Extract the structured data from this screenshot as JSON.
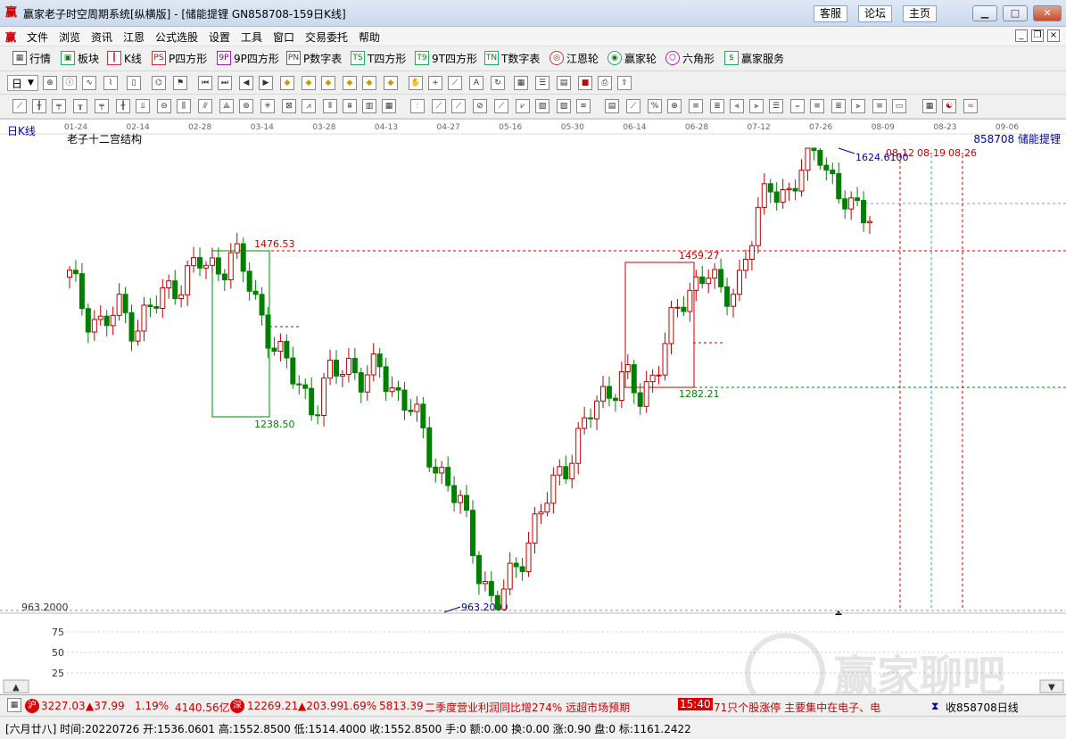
{
  "window": {
    "title": "赢家老子时空周期系统[纵横版] - [储能提锂  GN858708-159日K线]",
    "buttons": [
      "客服",
      "论坛",
      "主页"
    ]
  },
  "menu": [
    "文件",
    "浏览",
    "资讯",
    "江恩",
    "公式选股",
    "设置",
    "工具",
    "窗口",
    "交易委托",
    "帮助"
  ],
  "toolbar1": [
    {
      "label": "行情",
      "icon": "grid-icon"
    },
    {
      "label": "板块",
      "icon": "blocks-icon"
    },
    {
      "label": "K线",
      "icon": "candles-icon"
    },
    {
      "label": "P四方形",
      "icon": "PS"
    },
    {
      "label": "9P四方形",
      "icon": "9P"
    },
    {
      "label": "P数字表",
      "icon": "PN"
    },
    {
      "label": "T四方形",
      "icon": "TS"
    },
    {
      "label": "9T四方形",
      "icon": "T9"
    },
    {
      "label": "T数字表",
      "icon": "TN"
    },
    {
      "label": "江恩轮",
      "icon": "wheel-icon"
    },
    {
      "label": "赢家轮",
      "icon": "big-icon"
    },
    {
      "label": "六角形",
      "icon": "hex-icon"
    },
    {
      "label": "赢家服务",
      "icon": "dollar-icon"
    }
  ],
  "toolbar2": {
    "period": "日"
  },
  "chart": {
    "period_label": "日K线",
    "indicator_title": "老子十二宫结构",
    "code_name": "858708 储能提锂",
    "date_ticks": [
      "01-24",
      "02-14",
      "02-28",
      "03-14",
      "03-28",
      "04-13",
      "04-27",
      "05-16",
      "05-30",
      "06-14",
      "06-28",
      "07-12",
      "07-26",
      "08-09",
      "08-23",
      "09-06"
    ],
    "future_dates": [
      "08-12",
      "08-19",
      "08-26"
    ],
    "annotations": {
      "high": "1624.6100",
      "low": "963.2000",
      "low_axis": "963.2000",
      "box1_top": "1476.53",
      "box1_bottom": "1238.50",
      "box2_top": "1459.27",
      "box2_bottom": "1282.21"
    },
    "sub_axis": [
      "75",
      "50",
      "25"
    ],
    "colors": {
      "up": "#c00000",
      "down": "#008000",
      "box1": "#008000",
      "box2": "#c00000"
    }
  },
  "chart_data": {
    "type": "candlestick",
    "title": "老子十二宫结构",
    "x_ticks": [
      "01-24",
      "02-14",
      "02-28",
      "03-14",
      "03-28",
      "04-13",
      "04-27",
      "05-16",
      "05-30",
      "06-14",
      "06-28",
      "07-12",
      "07-26",
      "08-09",
      "08-23",
      "09-06"
    ],
    "marked_levels": [
      1624.61,
      1476.53,
      1459.27,
      1282.21,
      1238.5,
      963.2
    ],
    "close_path": [
      1440,
      1390,
      1370,
      1395,
      1370,
      1395,
      1420,
      1440,
      1460,
      1450,
      1476,
      1430,
      1370,
      1320,
      1290,
      1250,
      1300,
      1320,
      1290,
      1310,
      1275,
      1250,
      1190,
      1150,
      1110,
      1030,
      963,
      1010,
      1060,
      1110,
      1160,
      1200,
      1250,
      1280,
      1300,
      1260,
      1320,
      1380,
      1420,
      1459,
      1400,
      1440,
      1520,
      1570,
      1560,
      1600,
      1624,
      1560,
      1530,
      1540
    ]
  },
  "status1": {
    "sh_label": "沪",
    "sh_value": "3227.03",
    "sh_change": "▲37.99",
    "sh_pct": "1.19%",
    "sh_amount": "4140.56亿",
    "sz_label": "深",
    "sz_value": "12269.21",
    "sz_change": "▲203.99",
    "sz_pct": "1.69%",
    "sz_amount": "5813.39",
    "news1": "二季度营业利润同比增274% 远超市场预期",
    "time": "15:40",
    "news2": "71只个股涨停 主要集中在电子、电",
    "right": "收858708日线"
  },
  "status2": {
    "text": "[六月廿八] 时间:20220726 开:1536.0601 高:1552.8500 低:1514.4000 收:1552.8500 手:0 额:0.00 换:0.00 涨:0.90 盘:0 标:1161.2422"
  },
  "watermark": "赢家聊吧"
}
